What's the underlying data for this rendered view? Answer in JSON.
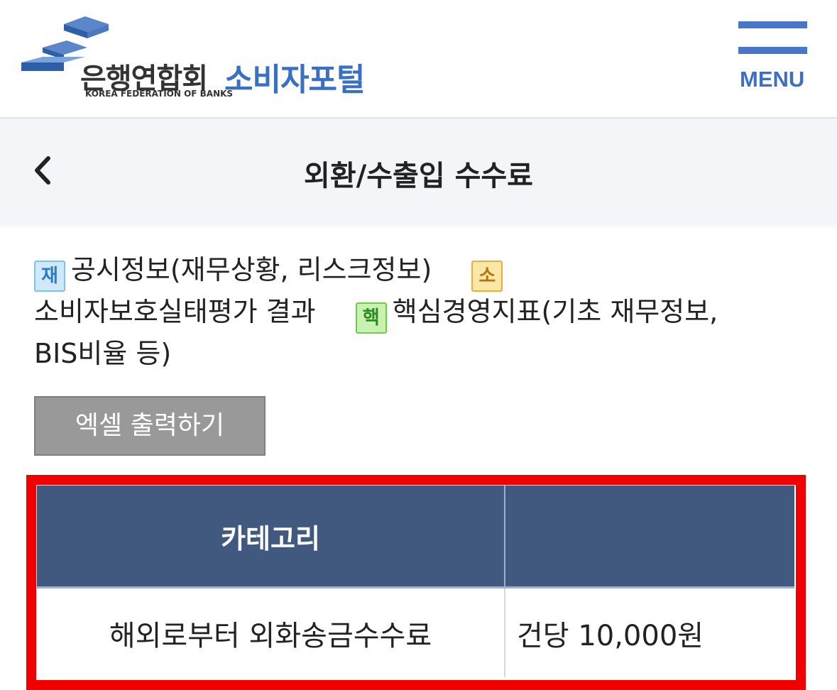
{
  "header": {
    "org_name_kor": "은행연합회",
    "org_name_eng": "KOREA FEDERATION OF BANKS",
    "portal_name": "소비자포털",
    "menu_label": "MENU",
    "brand_color": "#3a70c4"
  },
  "titlebar": {
    "back_icon": "chevron-left-icon",
    "title": "외환/수출입 수수료"
  },
  "legend": {
    "items": [
      {
        "badge": "재",
        "text": "공시정보(재무상황, 리스크정보)"
      },
      {
        "badge": "소",
        "text": "소비자보호실태평가 결과"
      },
      {
        "badge": "핵",
        "text": "핵심경영지표(기초 재무정보, BIS비율 등)"
      }
    ]
  },
  "excel_button": {
    "label": "엑셀 출력하기"
  },
  "table": {
    "headers": [
      "카테고리",
      ""
    ],
    "rows": [
      [
        "해외로부터 외화송금수수료",
        "건당 10,000원"
      ]
    ],
    "header_color": "#42597f",
    "highlight_color": "#f20000"
  }
}
